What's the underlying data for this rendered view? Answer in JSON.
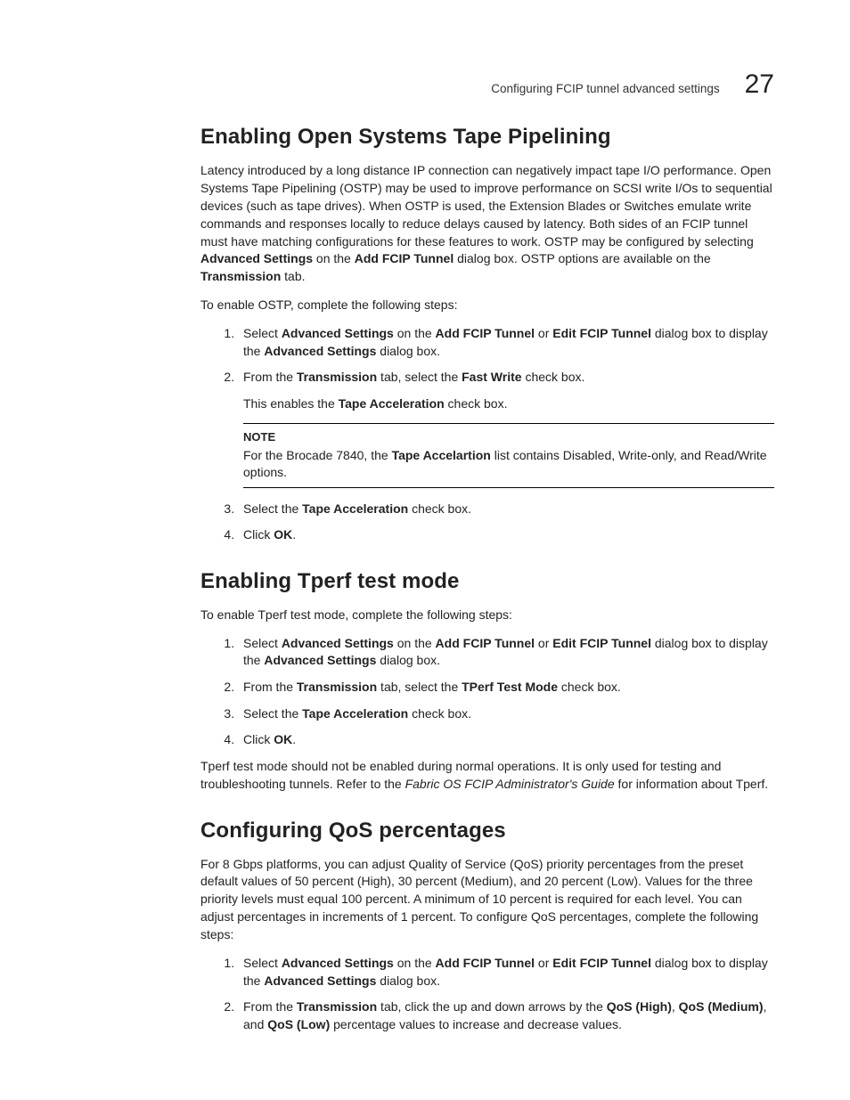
{
  "header": {
    "running_title": "Configuring FCIP tunnel advanced settings",
    "chapter_number": "27"
  },
  "sections": {
    "ostp": {
      "heading": "Enabling Open Systems Tape Pipelining",
      "intro_parts": [
        "Latency introduced by a long distance IP connection can negatively impact tape I/O performance. Open Systems Tape Pipelining (OSTP) may be used to improve performance on SCSI write I/Os to sequential devices (such as tape drives). When OSTP is used, the Extension Blades or Switches emulate write commands and responses locally to reduce delays caused by latency. Both sides of an FCIP tunnel must have matching configurations for these features to work. OSTP may be configured by selecting ",
        "Advanced Settings",
        " on the ",
        "Add FCIP Tunnel",
        " dialog box. OSTP options are available on the ",
        "Transmission",
        " tab."
      ],
      "lead_in": "To enable OSTP, complete the following steps:",
      "step1": {
        "pre": "Select ",
        "b1": "Advanced Settings",
        "mid1": " on the ",
        "b2": "Add FCIP Tunnel",
        "mid2": " or ",
        "b3": "Edit FCIP Tunnel",
        "mid3": " dialog box to display the ",
        "b4": "Advanced Settings",
        "end": " dialog box."
      },
      "step2": {
        "pre": "From the ",
        "b1": "Transmission",
        "mid1": " tab, select the ",
        "b2": "Fast Write",
        "end": " check box.",
        "sub_pre": "This enables the ",
        "sub_b": "Tape Acceleration",
        "sub_end": " check box.",
        "note_label": "NOTE",
        "note_pre": "For the Brocade 7840, the ",
        "note_b": "Tape Accelartion",
        "note_end": " list contains Disabled, Write-only, and Read/Write options."
      },
      "step3": {
        "pre": "Select the ",
        "b1": "Tape Acceleration",
        "end": " check box."
      },
      "step4": {
        "pre": "Click ",
        "b1": "OK",
        "end": "."
      }
    },
    "tperf": {
      "heading": "Enabling Tperf test mode",
      "lead_in": "To enable Tperf test mode, complete the following steps:",
      "step1": {
        "pre": "Select ",
        "b1": "Advanced Settings",
        "mid1": " on the ",
        "b2": "Add FCIP Tunnel",
        "mid2": " or ",
        "b3": "Edit FCIP Tunnel",
        "mid3": " dialog box to display the ",
        "b4": "Advanced Settings",
        "end": " dialog box."
      },
      "step2": {
        "pre": "From the ",
        "b1": "Transmission",
        "mid1": " tab, select the ",
        "b2": "TPerf Test Mode",
        "end": " check box."
      },
      "step3": {
        "pre": "Select the ",
        "b1": "Tape Acceleration",
        "end": " check box."
      },
      "step4": {
        "pre": "Click ",
        "b1": "OK",
        "end": "."
      },
      "closing_pre": "Tperf test mode should not be enabled during normal operations. It is only used for testing and troubleshooting tunnels. Refer to the ",
      "closing_i": "Fabric OS FCIP Administrator's Guide",
      "closing_end": " for information about Tperf."
    },
    "qos": {
      "heading": "Configuring QoS percentages",
      "intro": "For 8 Gbps platforms, you can adjust Quality of Service (QoS) priority percentages from the preset default values of 50 percent (High), 30 percent (Medium), and 20 percent (Low). Values for the three priority levels must equal 100 percent. A minimum of 10 percent is required for each level. You can adjust percentages in increments of 1 percent. To configure QoS percentages, complete the following steps:",
      "step1": {
        "pre": "Select ",
        "b1": "Advanced Settings",
        "mid1": " on the ",
        "b2": "Add FCIP Tunnel",
        "mid2": " or ",
        "b3": "Edit FCIP Tunnel",
        "mid3": " dialog box to display the ",
        "b4": "Advanced Settings",
        "end": " dialog box."
      },
      "step2": {
        "pre": "From the ",
        "b1": "Transmission",
        "mid1": " tab, click the up and down arrows by the ",
        "b2": "QoS (High)",
        "mid2": ", ",
        "b3": "QoS (Medium)",
        "mid3": ", and ",
        "b4": "QoS (Low)",
        "end": " percentage values to increase and decrease values."
      }
    }
  }
}
